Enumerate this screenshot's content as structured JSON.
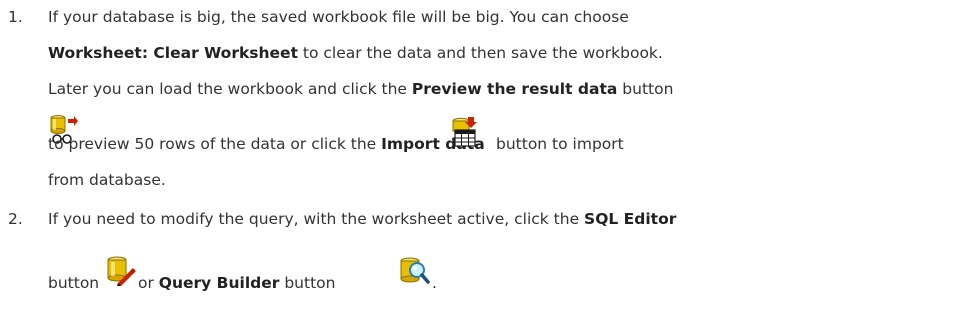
{
  "steps": [
    {
      "number": "1.",
      "line1": "If your database is big, the saved workbook file will be big. You can choose",
      "line2_bold": "Worksheet: Clear Worksheet",
      "line2_rest": " to clear the data and then save the workbook.",
      "line3_pre": "Later you can load the workbook and click the ",
      "line3_bold": "Preview the result data",
      "line3_post": " button",
      "line4_pre": "to preview 50 rows of the data or click the ",
      "line4_bold": "Import data",
      "line4_post": "button to import",
      "line5": "from database."
    },
    {
      "number": "2.",
      "line1_pre": "If you need to modify the query, with the worksheet active, click the ",
      "line1_bold": "SQL Editor",
      "line2_pre": "button ",
      "line2_mid": "or ",
      "line2_bold": "Query Builder",
      "line2_post": " button ",
      "line2_end": "."
    }
  ],
  "icons": {
    "preview": "preview-result-data-icon",
    "import": "import-data-icon",
    "sql_editor": "sql-editor-icon",
    "query_builder": "query-builder-icon"
  },
  "colors": {
    "text": "#333333",
    "icon_yellow": "#e8c000",
    "icon_red": "#cc2200"
  }
}
